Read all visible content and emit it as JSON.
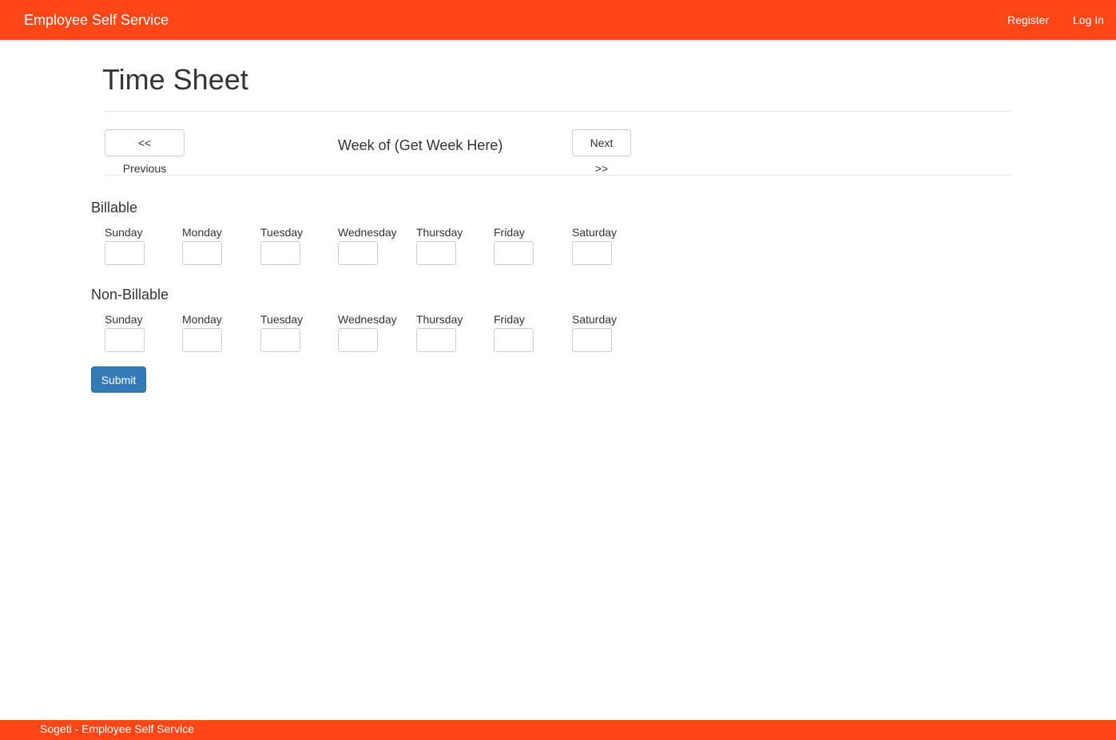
{
  "navbar": {
    "brand": "Employee Self Service",
    "links": [
      {
        "label": "Register"
      },
      {
        "label": "Log In"
      }
    ]
  },
  "page": {
    "title": "Time Sheet",
    "previous_label": "<< Previous",
    "week_label": "Week of (Get Week Here)",
    "next_label": "Next >>"
  },
  "billable": {
    "title": "Billable",
    "days": [
      "Sunday",
      "Monday",
      "Tuesday",
      "Wednesday",
      "Thursday",
      "Friday",
      "Saturday"
    ],
    "values": [
      "",
      "",
      "",
      "",
      "",
      "",
      ""
    ]
  },
  "non_billable": {
    "title": "Non-Billable",
    "days": [
      "Sunday",
      "Monday",
      "Tuesday",
      "Wednesday",
      "Thursday",
      "Friday",
      "Saturday"
    ],
    "values": [
      "",
      "",
      "",
      "",
      "",
      "",
      ""
    ]
  },
  "form": {
    "submit_label": "Submit"
  },
  "footer": {
    "text": "Sogeti - Employee Self Service"
  },
  "colors": {
    "brand_orange": "#ff4616",
    "primary_blue": "#337ab7"
  }
}
